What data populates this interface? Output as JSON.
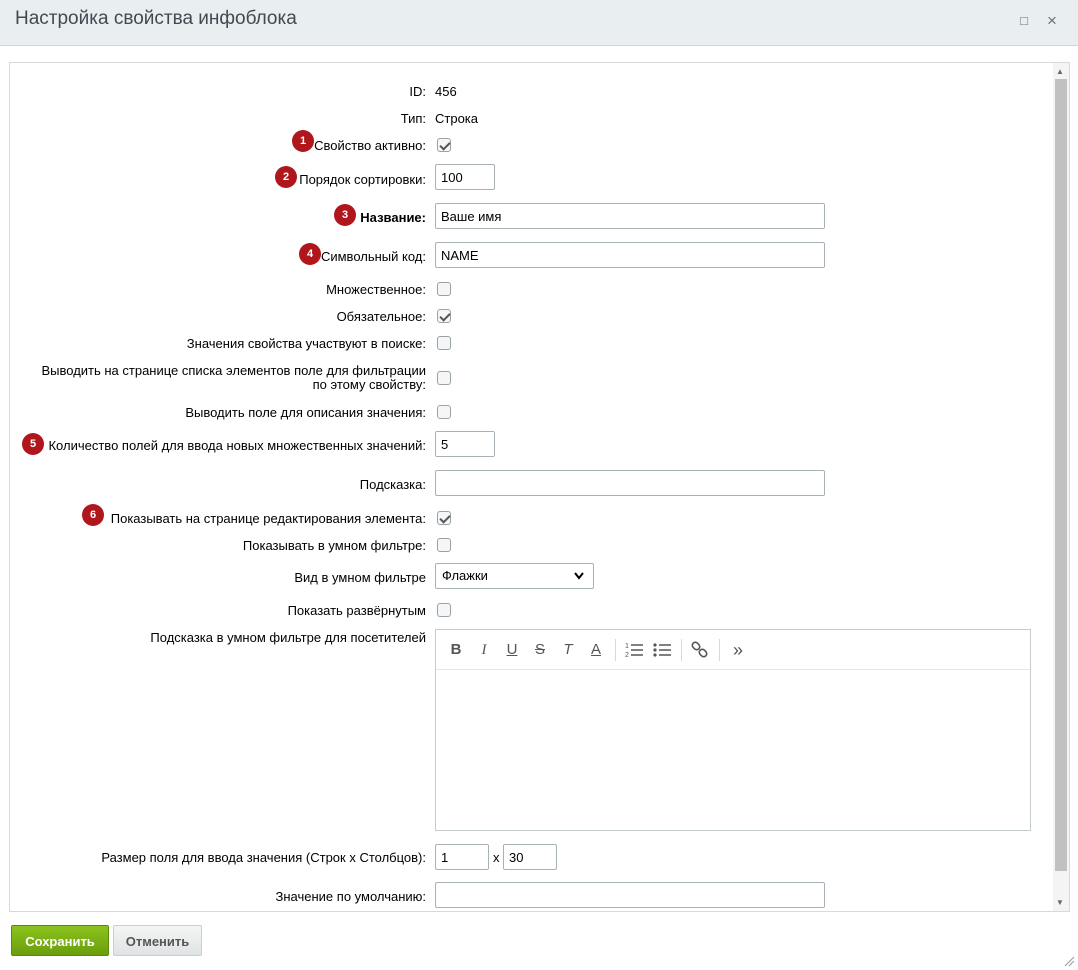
{
  "window": {
    "title": "Настройка свойства инфоблока",
    "maximize_icon": "□",
    "close_icon": "×"
  },
  "form": {
    "id_label": "ID:",
    "id_value": "456",
    "type_label": "Тип:",
    "type_value": "Строка",
    "active_label": "Свойство активно:",
    "active_checked": true,
    "sort_label": "Порядок сортировки:",
    "sort_value": "100",
    "name_label": "Название:",
    "name_value": "Ваше имя",
    "code_label": "Символьный код:",
    "code_value": "NAME",
    "multiple_label": "Множественное:",
    "multiple_checked": false,
    "required_label": "Обязательное:",
    "required_checked": true,
    "search_label": "Значения свойства участвуют в поиске:",
    "search_checked": false,
    "filter_label_line1": "Выводить на странице списка элементов поле для фильтрации",
    "filter_label_line2": "по этому свойству:",
    "filter_checked": false,
    "desc_label": "Выводить поле для описания значения:",
    "desc_checked": false,
    "multi_count_label": "Количество полей для ввода новых множественных значений:",
    "multi_count_value": "5",
    "hint_label": "Подсказка:",
    "hint_value": "",
    "show_edit_label": "Показывать на странице редактирования элемента:",
    "show_edit_checked": true,
    "smart_filter_label": "Показывать в умном фильтре:",
    "smart_filter_checked": false,
    "smart_view_label": "Вид в умном фильтре",
    "smart_view_value": "Флажки",
    "expanded_label": "Показать развёрнутым",
    "expanded_checked": false,
    "smart_hint_label": "Подсказка в умном фильтре для посетителей",
    "size_label": "Размер поля для ввода значения (Строк х Столбцов):",
    "size_rows": "1",
    "size_x": "x",
    "size_cols": "30",
    "default_label": "Значение по умолчанию:",
    "default_value": ""
  },
  "markers": [
    "1",
    "2",
    "3",
    "4",
    "5",
    "6"
  ],
  "editor_toolbar": {
    "bold": "B",
    "italic": "I",
    "underline": "U",
    "strike": "S",
    "clear_format": "T",
    "font_color": "A",
    "ordered_list": "ordered-list-icon",
    "bullet_list": "bullet-list-icon",
    "link": "link-icon",
    "more": "»"
  },
  "buttons": {
    "save": "Сохранить",
    "cancel": "Отменить"
  }
}
